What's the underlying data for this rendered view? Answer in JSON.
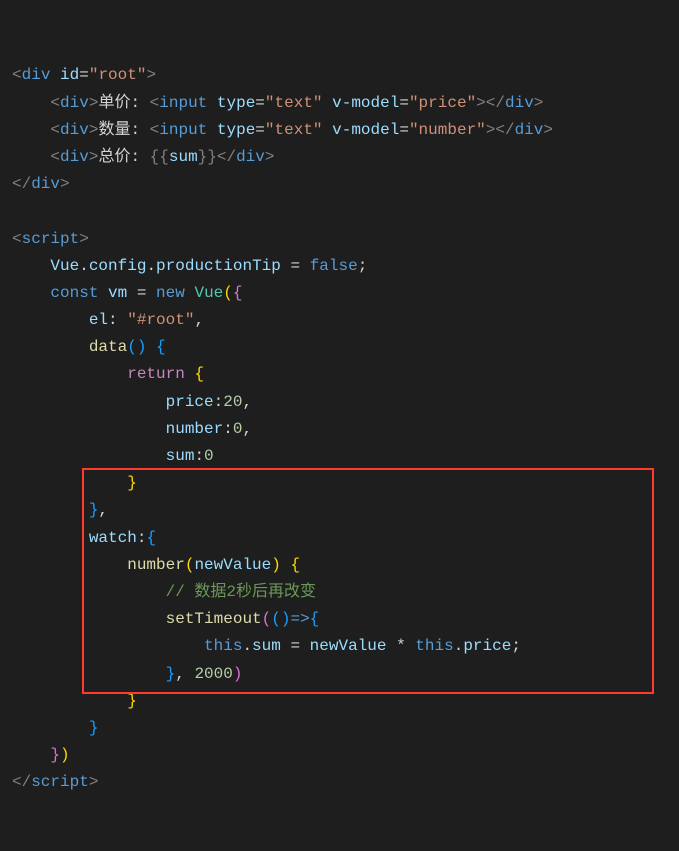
{
  "code": {
    "lines": [
      {
        "indent": 0,
        "tokens": [
          {
            "t": "<",
            "c": "tag-bracket"
          },
          {
            "t": "div",
            "c": "tag-name"
          },
          {
            "t": " ",
            "c": "text"
          },
          {
            "t": "id",
            "c": "attr-name"
          },
          {
            "t": "=",
            "c": "text"
          },
          {
            "t": "\"root\"",
            "c": "attr-value"
          },
          {
            "t": ">",
            "c": "tag-bracket"
          }
        ]
      },
      {
        "indent": 1,
        "tokens": [
          {
            "t": "<",
            "c": "tag-bracket"
          },
          {
            "t": "div",
            "c": "tag-name"
          },
          {
            "t": ">",
            "c": "tag-bracket"
          },
          {
            "t": "单价: ",
            "c": "text"
          },
          {
            "t": "<",
            "c": "tag-bracket"
          },
          {
            "t": "input",
            "c": "tag-name"
          },
          {
            "t": " ",
            "c": "text"
          },
          {
            "t": "type",
            "c": "attr-name"
          },
          {
            "t": "=",
            "c": "text"
          },
          {
            "t": "\"text\"",
            "c": "attr-value"
          },
          {
            "t": " ",
            "c": "text"
          },
          {
            "t": "v-model",
            "c": "attr-name"
          },
          {
            "t": "=",
            "c": "text"
          },
          {
            "t": "\"price\"",
            "c": "attr-value"
          },
          {
            "t": "></",
            "c": "tag-bracket"
          },
          {
            "t": "div",
            "c": "tag-name"
          },
          {
            "t": ">",
            "c": "tag-bracket"
          }
        ]
      },
      {
        "indent": 1,
        "tokens": [
          {
            "t": "<",
            "c": "tag-bracket"
          },
          {
            "t": "div",
            "c": "tag-name"
          },
          {
            "t": ">",
            "c": "tag-bracket"
          },
          {
            "t": "数量: ",
            "c": "text"
          },
          {
            "t": "<",
            "c": "tag-bracket"
          },
          {
            "t": "input",
            "c": "tag-name"
          },
          {
            "t": " ",
            "c": "text"
          },
          {
            "t": "type",
            "c": "attr-name"
          },
          {
            "t": "=",
            "c": "text"
          },
          {
            "t": "\"text\"",
            "c": "attr-value"
          },
          {
            "t": " ",
            "c": "text"
          },
          {
            "t": "v-model",
            "c": "attr-name"
          },
          {
            "t": "=",
            "c": "text"
          },
          {
            "t": "\"number\"",
            "c": "attr-value"
          },
          {
            "t": "></",
            "c": "tag-bracket"
          },
          {
            "t": "div",
            "c": "tag-name"
          },
          {
            "t": ">",
            "c": "tag-bracket"
          }
        ]
      },
      {
        "indent": 1,
        "tokens": [
          {
            "t": "<",
            "c": "tag-bracket"
          },
          {
            "t": "div",
            "c": "tag-name"
          },
          {
            "t": ">",
            "c": "tag-bracket"
          },
          {
            "t": "总价: ",
            "c": "text"
          },
          {
            "t": "{{",
            "c": "tag-bracket"
          },
          {
            "t": "sum",
            "c": "identifier"
          },
          {
            "t": "}}",
            "c": "tag-bracket"
          },
          {
            "t": "</",
            "c": "tag-bracket"
          },
          {
            "t": "div",
            "c": "tag-name"
          },
          {
            "t": ">",
            "c": "tag-bracket"
          }
        ]
      },
      {
        "indent": 0,
        "tokens": [
          {
            "t": "</",
            "c": "tag-bracket"
          },
          {
            "t": "div",
            "c": "tag-name"
          },
          {
            "t": ">",
            "c": "tag-bracket"
          }
        ]
      },
      {
        "indent": 0,
        "tokens": []
      },
      {
        "indent": 0,
        "tokens": [
          {
            "t": "<",
            "c": "tag-bracket"
          },
          {
            "t": "script",
            "c": "tag-name"
          },
          {
            "t": ">",
            "c": "tag-bracket"
          }
        ]
      },
      {
        "indent": 1,
        "tokens": [
          {
            "t": "Vue",
            "c": "identifier"
          },
          {
            "t": ".",
            "c": "text"
          },
          {
            "t": "config",
            "c": "identifier"
          },
          {
            "t": ".",
            "c": "text"
          },
          {
            "t": "productionTip",
            "c": "identifier"
          },
          {
            "t": " = ",
            "c": "text"
          },
          {
            "t": "false",
            "c": "bool"
          },
          {
            "t": ";",
            "c": "text"
          }
        ]
      },
      {
        "indent": 1,
        "tokens": [
          {
            "t": "const",
            "c": "keyword"
          },
          {
            "t": " ",
            "c": "text"
          },
          {
            "t": "vm",
            "c": "identifier"
          },
          {
            "t": " = ",
            "c": "text"
          },
          {
            "t": "new",
            "c": "keyword"
          },
          {
            "t": " ",
            "c": "text"
          },
          {
            "t": "Vue",
            "c": "class-name"
          },
          {
            "t": "(",
            "c": "paren"
          },
          {
            "t": "{",
            "c": "brace2"
          }
        ]
      },
      {
        "indent": 2,
        "tokens": [
          {
            "t": "el",
            "c": "identifier"
          },
          {
            "t": ":",
            "c": "text"
          },
          {
            "t": " ",
            "c": "text"
          },
          {
            "t": "\"#root\"",
            "c": "string"
          },
          {
            "t": ",",
            "c": "text"
          }
        ]
      },
      {
        "indent": 2,
        "tokens": [
          {
            "t": "data",
            "c": "func-name"
          },
          {
            "t": "(",
            "c": "paren3"
          },
          {
            "t": ")",
            "c": "paren3"
          },
          {
            "t": " ",
            "c": "text"
          },
          {
            "t": "{",
            "c": "brace3"
          }
        ]
      },
      {
        "indent": 3,
        "tokens": [
          {
            "t": "return",
            "c": "keyword-control"
          },
          {
            "t": " ",
            "c": "text"
          },
          {
            "t": "{",
            "c": "brace"
          }
        ]
      },
      {
        "indent": 4,
        "tokens": [
          {
            "t": "price",
            "c": "identifier"
          },
          {
            "t": ":",
            "c": "text"
          },
          {
            "t": "20",
            "c": "number"
          },
          {
            "t": ",",
            "c": "text"
          }
        ]
      },
      {
        "indent": 4,
        "tokens": [
          {
            "t": "number",
            "c": "identifier"
          },
          {
            "t": ":",
            "c": "text"
          },
          {
            "t": "0",
            "c": "number"
          },
          {
            "t": ",",
            "c": "text"
          }
        ]
      },
      {
        "indent": 4,
        "tokens": [
          {
            "t": "sum",
            "c": "identifier"
          },
          {
            "t": ":",
            "c": "text"
          },
          {
            "t": "0",
            "c": "number"
          }
        ]
      },
      {
        "indent": 3,
        "tokens": [
          {
            "t": "}",
            "c": "brace"
          }
        ]
      },
      {
        "indent": 2,
        "tokens": [
          {
            "t": "}",
            "c": "brace3"
          },
          {
            "t": ",",
            "c": "text"
          }
        ]
      },
      {
        "indent": 2,
        "tokens": [
          {
            "t": "watch",
            "c": "identifier"
          },
          {
            "t": ":",
            "c": "text"
          },
          {
            "t": "{",
            "c": "brace3"
          }
        ]
      },
      {
        "indent": 3,
        "tokens": [
          {
            "t": "number",
            "c": "func-name"
          },
          {
            "t": "(",
            "c": "paren"
          },
          {
            "t": "newValue",
            "c": "identifier"
          },
          {
            "t": ")",
            "c": "paren"
          },
          {
            "t": " ",
            "c": "text"
          },
          {
            "t": "{",
            "c": "brace"
          }
        ]
      },
      {
        "indent": 4,
        "tokens": [
          {
            "t": "// 数据2秒后再改变",
            "c": "comment"
          }
        ]
      },
      {
        "indent": 4,
        "tokens": [
          {
            "t": "setTimeout",
            "c": "func-name"
          },
          {
            "t": "(",
            "c": "paren2"
          },
          {
            "t": "(",
            "c": "paren3"
          },
          {
            "t": ")",
            "c": "paren3"
          },
          {
            "t": "=>",
            "c": "keyword"
          },
          {
            "t": "{",
            "c": "brace3"
          }
        ]
      },
      {
        "indent": 5,
        "tokens": [
          {
            "t": "this",
            "c": "this"
          },
          {
            "t": ".",
            "c": "text"
          },
          {
            "t": "sum",
            "c": "identifier"
          },
          {
            "t": " = ",
            "c": "text"
          },
          {
            "t": "newValue",
            "c": "identifier"
          },
          {
            "t": " * ",
            "c": "text"
          },
          {
            "t": "this",
            "c": "this"
          },
          {
            "t": ".",
            "c": "text"
          },
          {
            "t": "price",
            "c": "identifier"
          },
          {
            "t": ";",
            "c": "text"
          }
        ]
      },
      {
        "indent": 4,
        "tokens": [
          {
            "t": "}",
            "c": "brace3"
          },
          {
            "t": ", ",
            "c": "text"
          },
          {
            "t": "2000",
            "c": "number"
          },
          {
            "t": ")",
            "c": "paren2"
          }
        ]
      },
      {
        "indent": 3,
        "tokens": [
          {
            "t": "}",
            "c": "brace"
          }
        ]
      },
      {
        "indent": 2,
        "tokens": [
          {
            "t": "}",
            "c": "brace3"
          }
        ]
      },
      {
        "indent": 1,
        "tokens": [
          {
            "t": "}",
            "c": "brace2"
          },
          {
            "t": ")",
            "c": "paren"
          }
        ]
      },
      {
        "indent": 0,
        "tokens": [
          {
            "t": "</",
            "c": "tag-bracket"
          },
          {
            "t": "script",
            "c": "tag-name"
          },
          {
            "t": ">",
            "c": "tag-bracket"
          }
        ]
      }
    ]
  }
}
